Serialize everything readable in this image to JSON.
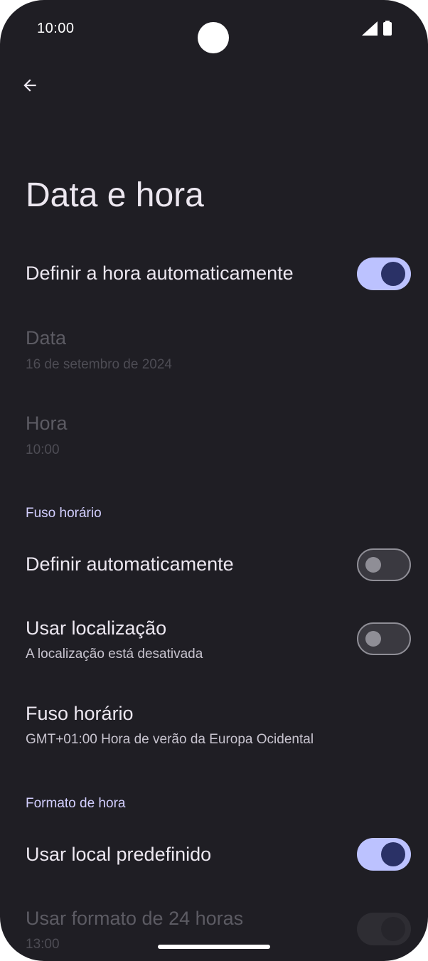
{
  "status_bar": {
    "time": "10:00"
  },
  "page": {
    "title": "Data e hora"
  },
  "settings": {
    "auto_time": {
      "title": "Definir a hora automaticamente",
      "state": "on"
    },
    "date": {
      "title": "Data",
      "value": "16 de setembro de 2024"
    },
    "time": {
      "title": "Hora",
      "value": "10:00"
    },
    "timezone_section": {
      "header": "Fuso horário"
    },
    "auto_timezone": {
      "title": "Definir automaticamente",
      "state": "off"
    },
    "use_location": {
      "title": "Usar localização",
      "subtitle": "A localização está desativada",
      "state": "off"
    },
    "timezone": {
      "title": "Fuso horário",
      "value": "GMT+01:00 Hora de verão da Europa Ocidental"
    },
    "format_section": {
      "header": "Formato de hora"
    },
    "use_locale_default": {
      "title": "Usar local predefinido",
      "state": "on"
    },
    "use_24h": {
      "title": "Usar formato de 24 horas",
      "value": "13:00",
      "state": "disabled"
    }
  },
  "colors": {
    "background": "#1f1e24",
    "switch_on_track": "#bcc2ff",
    "switch_on_thumb": "#2a3166",
    "section_header": "#d3cfff"
  },
  "icons": {
    "back": "arrow-back-icon",
    "signal": "cell-signal-icon",
    "battery": "battery-icon"
  }
}
